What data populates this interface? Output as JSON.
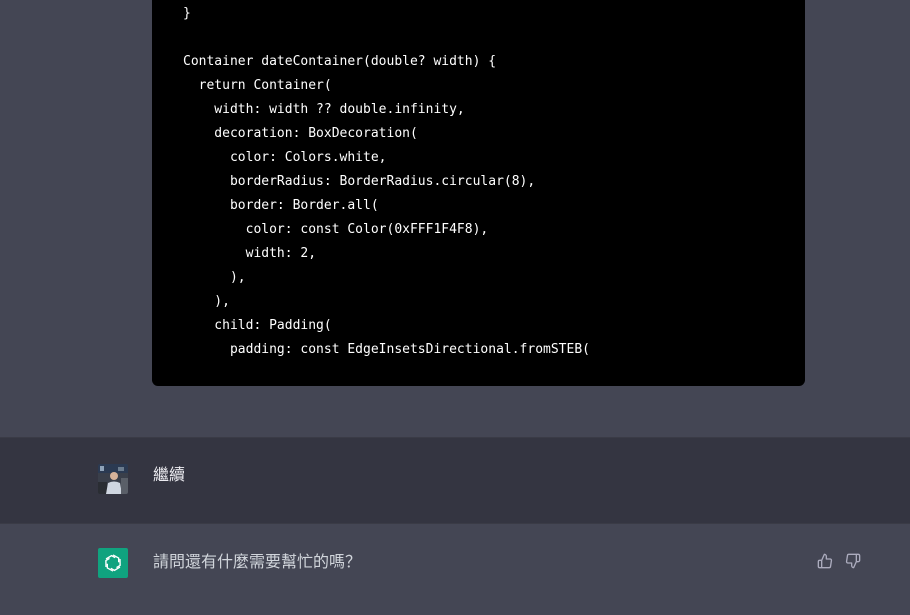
{
  "code_block": {
    "lines": [
      "  }",
      "}",
      "",
      "Container dateContainer(double? width) {",
      "  return Container(",
      "    width: width ?? double.infinity,",
      "    decoration: BoxDecoration(",
      "      color: Colors.white,",
      "      borderRadius: BorderRadius.circular(8),",
      "      border: Border.all(",
      "        color: const Color(0xFFF1F4F8),",
      "        width: 2,",
      "      ),",
      "    ),",
      "    child: Padding(",
      "      padding: const EdgeInsetsDirectional.fromSTEB("
    ]
  },
  "user_message": {
    "text": "繼續",
    "avatar_icon": "user-photo-avatar"
  },
  "assistant_message": {
    "text": "請問還有什麼需要幫忙的嗎？",
    "avatar_icon": "openai-logo-icon",
    "avatar_color": "#10a37f"
  },
  "feedback": {
    "thumbs_up_icon": "thumbs-up-icon",
    "thumbs_down_icon": "thumbs-down-icon"
  },
  "colors": {
    "assistant_bg": "#444654",
    "user_bg": "#343541",
    "code_bg": "#000000"
  }
}
